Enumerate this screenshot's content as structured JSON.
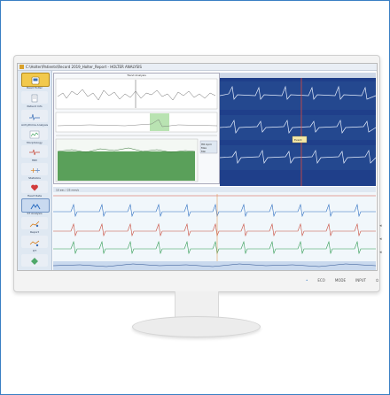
{
  "window": {
    "title": "C:\\Holter\\Patients\\Record 2019_Holter_Report - HOLTER ANALYSIS"
  },
  "sidebar": {
    "items": [
      {
        "label": "Read Holter",
        "icon": "holter-device-icon",
        "active": true
      },
      {
        "label": "Patient Info",
        "icon": "document-icon"
      },
      {
        "label": "Arrhythmia Analysis",
        "icon": "waveform-icon"
      },
      {
        "label": "Morphology",
        "icon": "chart-icon"
      },
      {
        "label": "HRV",
        "icon": "pulse-icon"
      },
      {
        "label": "Statistics",
        "icon": "plus-minus-icon"
      },
      {
        "label": "Heart Rate",
        "icon": "heart-icon"
      },
      {
        "label": "ST Analysis",
        "icon": "st-segment-icon"
      },
      {
        "label": "Report",
        "icon": "trend-icon"
      },
      {
        "label": "QT",
        "icon": "qt-trend-icon"
      },
      {
        "label": "Print",
        "icon": "print-icon"
      }
    ]
  },
  "trend_panel": {
    "title": "Trend Analysis",
    "legend": [
      "HR bpm",
      "Max",
      "Min"
    ]
  },
  "ecg_panel": {
    "toolbar_label": "10 sec / 25 mm/s",
    "marker_label": "Event",
    "event_label": "VES"
  },
  "colors": {
    "ecg_blue": "#2a6cc0",
    "ecg_red": "#c84a3a",
    "ecg_green": "#2f9a52",
    "histogram_green": "#5aa05a",
    "dark_panel": "#1f3f8a",
    "sidebar_bg": "#dfe8f2"
  },
  "monitor": {
    "bezel_labels": [
      "ECO",
      "MODE",
      "INPUT"
    ]
  }
}
